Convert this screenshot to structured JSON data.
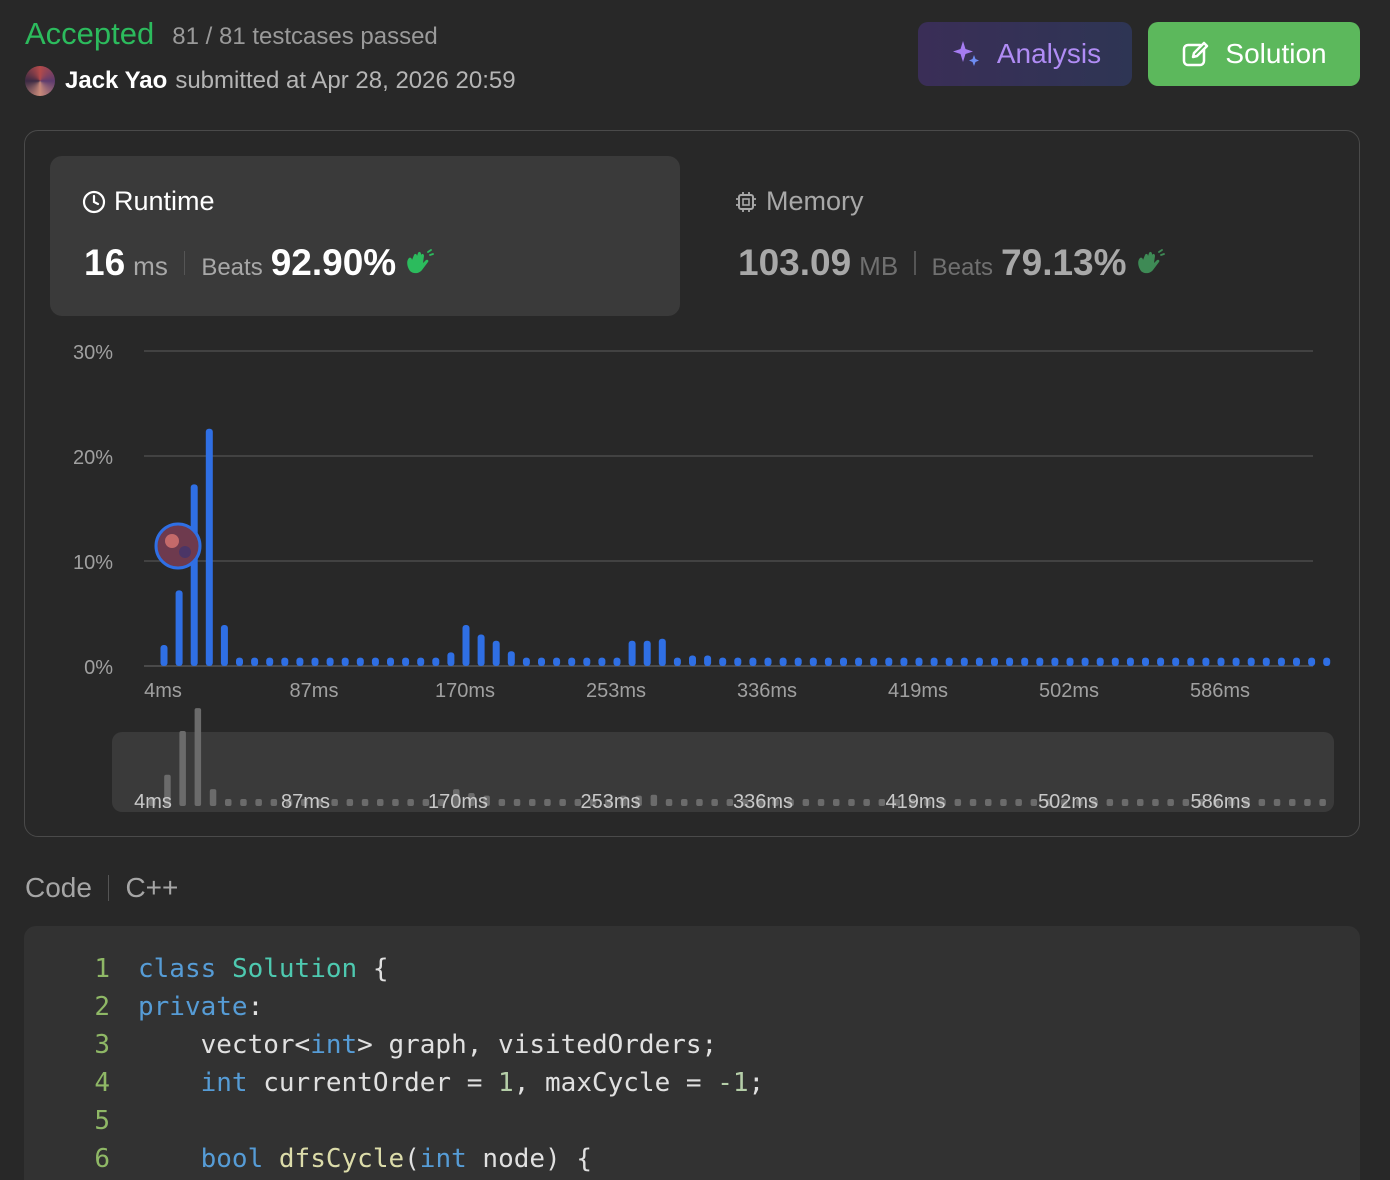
{
  "header": {
    "status": "Accepted",
    "testcases": "81 / 81 testcases passed",
    "user_name": "Jack Yao",
    "submitted_text": "submitted at Apr 28, 2026 20:59",
    "analysis_label": "Analysis",
    "solution_label": "Solution"
  },
  "runtime": {
    "title": "Runtime",
    "value": "16",
    "unit": "ms",
    "beats_label": "Beats",
    "beats_pct": "92.90%"
  },
  "memory": {
    "title": "Memory",
    "value": "103.09",
    "unit": "MB",
    "beats_label": "Beats",
    "beats_pct": "79.13%"
  },
  "colors": {
    "accepted": "#2cbb5d",
    "bar": "#2f6fe4",
    "analysis_text": "#b08cf5",
    "solution_bg": "#5cb85c"
  },
  "chart_data": {
    "type": "bar",
    "title": "",
    "xlabel": "",
    "ylabel": "",
    "y_ticks": [
      "30%",
      "20%",
      "10%",
      "0%"
    ],
    "ylim": [
      0,
      30
    ],
    "x_tick_labels": [
      "4ms",
      "87ms",
      "170ms",
      "253ms",
      "336ms",
      "419ms",
      "502ms",
      "586ms"
    ],
    "user_marker_bin": 2,
    "values": [
      2.0,
      7.2,
      17.3,
      22.6,
      3.9,
      0.8,
      0.8,
      0.8,
      0.8,
      0.8,
      0.8,
      0.8,
      0.8,
      0.8,
      0.8,
      0.8,
      0.8,
      0.8,
      0.8,
      1.3,
      3.9,
      3.0,
      2.4,
      1.4,
      0.8,
      0.8,
      0.8,
      0.8,
      0.8,
      0.8,
      0.8,
      2.4,
      2.4,
      2.6,
      0.8,
      1.0,
      1.0,
      0.8,
      0.8,
      0.8,
      0.8,
      0.8,
      0.8,
      0.8,
      0.8,
      0.8,
      0.8,
      0.8,
      0.8,
      0.8,
      0.8,
      0.8,
      0.8,
      0.8,
      0.8,
      0.8,
      0.8,
      0.8,
      0.8,
      0.8,
      0.8,
      0.8,
      0.8,
      0.8,
      0.8,
      0.8,
      0.8,
      0.8,
      0.8,
      0.8,
      0.8,
      0.8,
      0.8,
      0.8,
      0.8,
      0.8,
      0.8,
      0.8
    ]
  },
  "code": {
    "title": "Code",
    "language": "C++",
    "lines": [
      {
        "num": "1",
        "tokens": [
          {
            "t": "class",
            "c": "kw"
          },
          {
            "t": " ",
            "c": "pl"
          },
          {
            "t": "Solution",
            "c": "ty"
          },
          {
            "t": " {",
            "c": "pl"
          }
        ]
      },
      {
        "num": "2",
        "tokens": [
          {
            "t": "private",
            "c": "kw"
          },
          {
            "t": ":",
            "c": "pl"
          }
        ]
      },
      {
        "num": "3",
        "tokens": [
          {
            "t": "    vector<",
            "c": "pl"
          },
          {
            "t": "int",
            "c": "kw"
          },
          {
            "t": "> graph, visitedOrders;",
            "c": "pl"
          }
        ]
      },
      {
        "num": "4",
        "tokens": [
          {
            "t": "    ",
            "c": "pl"
          },
          {
            "t": "int",
            "c": "kw"
          },
          {
            "t": " currentOrder = ",
            "c": "pl"
          },
          {
            "t": "1",
            "c": "nm"
          },
          {
            "t": ", maxCycle = ",
            "c": "pl"
          },
          {
            "t": "-1",
            "c": "nm"
          },
          {
            "t": ";",
            "c": "pl"
          }
        ]
      },
      {
        "num": "5",
        "tokens": []
      },
      {
        "num": "6",
        "tokens": [
          {
            "t": "    ",
            "c": "pl"
          },
          {
            "t": "bool",
            "c": "kw"
          },
          {
            "t": " ",
            "c": "pl"
          },
          {
            "t": "dfsCycle",
            "c": "fn"
          },
          {
            "t": "(",
            "c": "pl"
          },
          {
            "t": "int",
            "c": "kw"
          },
          {
            "t": " node) {",
            "c": "pl"
          }
        ]
      }
    ]
  }
}
